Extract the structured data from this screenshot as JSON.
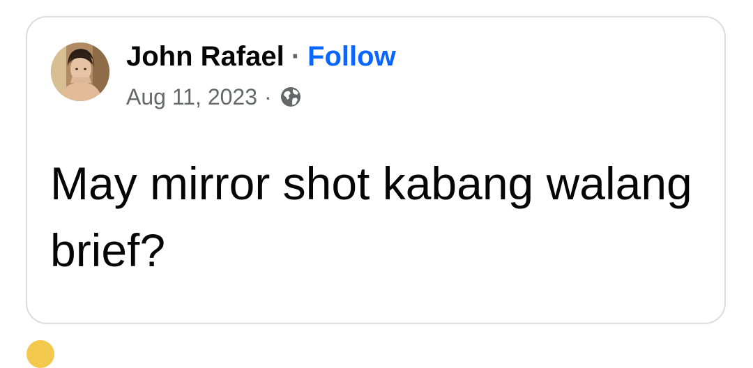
{
  "post": {
    "author_name": "John Rafael",
    "separator": "·",
    "follow_label": "Follow",
    "date": "Aug 11, 2023",
    "privacy_icon": "globe-icon",
    "text": "May mirror shot kabang walang brief?"
  },
  "colors": {
    "follow_blue": "#0866ff",
    "secondary_text": "#65676b",
    "primary_text": "#050505",
    "card_border": "#dcdcdc"
  }
}
